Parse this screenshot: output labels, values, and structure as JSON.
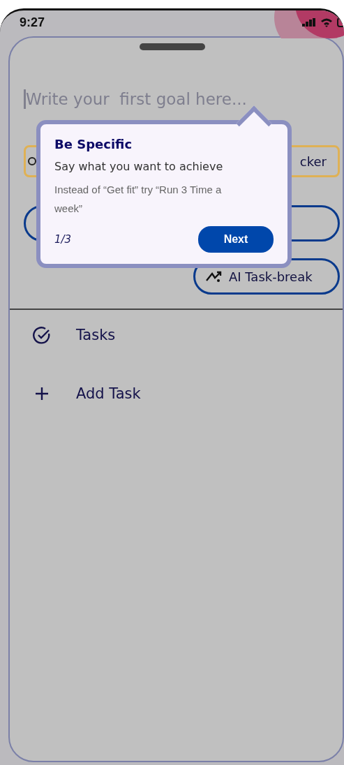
{
  "status_bar": {
    "time": "9:27"
  },
  "goal_input": {
    "placeholder": "Write your  first goal here..."
  },
  "chips": [
    {
      "kind": "tracker",
      "label": "cker"
    },
    {
      "kind": "blank"
    },
    {
      "kind": "ai",
      "label": "AI Task-break"
    }
  ],
  "tooltip": {
    "title": "Be Specific",
    "subtitle": "Say what you want to achieve",
    "body": "Instead of “Get fit” try “Run 3 Time a week”",
    "step": "1/3",
    "button": "Next"
  },
  "list": [
    {
      "kind": "check",
      "label": "Tasks"
    },
    {
      "kind": "add",
      "label": "Add Task"
    }
  ]
}
